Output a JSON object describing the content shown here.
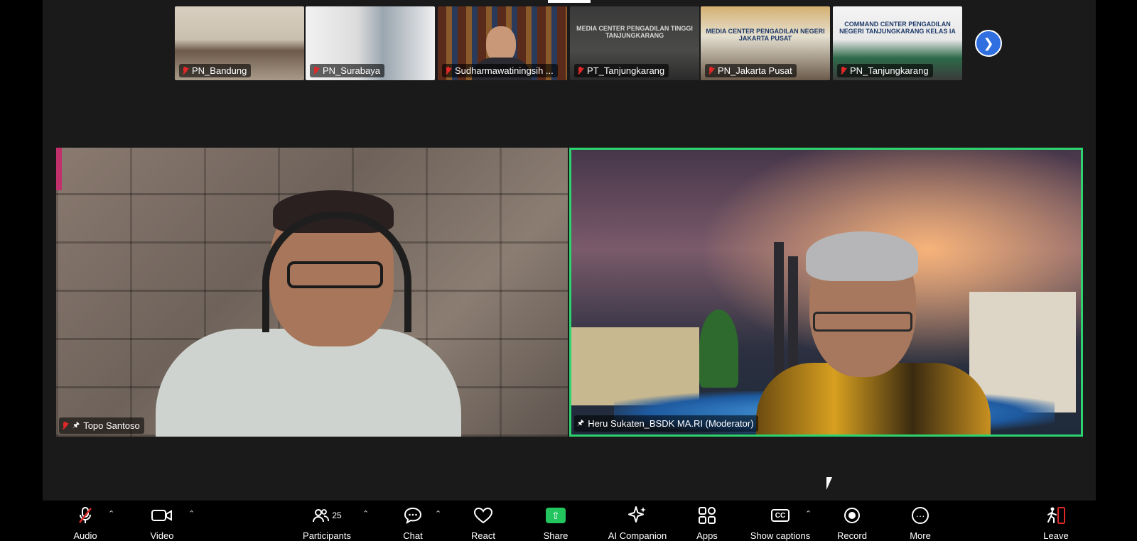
{
  "thumbnails": [
    {
      "label": "PN_Bandung",
      "muted": true
    },
    {
      "label": "PN_Surabaya",
      "muted": true
    },
    {
      "label": "Sudharmawatiningsih ...",
      "muted": true
    },
    {
      "label": "PT_Tanjungkarang",
      "muted": true,
      "sign": "MEDIA CENTER PENGADILAN TINGGI TANJUNGKARANG"
    },
    {
      "label": "PN_Jakarta Pusat",
      "muted": true,
      "sign": "MEDIA CENTER PENGADILAN NEGERI JAKARTA PUSAT"
    },
    {
      "label": "PN_Tanjungkarang",
      "muted": true,
      "sign": "COMMAND CENTER PENGADILAN NEGERI TANJUNGKARANG KELAS IA"
    }
  ],
  "gallery": {
    "next_icon": "chevron-right-icon"
  },
  "speakers": [
    {
      "name": "Topo Santoso",
      "muted": true,
      "pinned": true,
      "active": false
    },
    {
      "name": "Heru Sukaten_BSDK MA.RI (Moderator)",
      "muted": false,
      "pinned": true,
      "active": true
    }
  ],
  "toolbar": {
    "audio": "Audio",
    "video": "Video",
    "participants": "Participants",
    "participant_count": "25",
    "chat": "Chat",
    "react": "React",
    "share": "Share",
    "ai_companion": "AI Companion",
    "apps": "Apps",
    "captions": "Show captions",
    "record": "Record",
    "more": "More",
    "leave": "Leave"
  },
  "colors": {
    "active_speaker_border": "#2dd36f",
    "share_green": "#22c55e",
    "muted_red": "#e02828",
    "next_button_blue": "#2f6fe0"
  }
}
